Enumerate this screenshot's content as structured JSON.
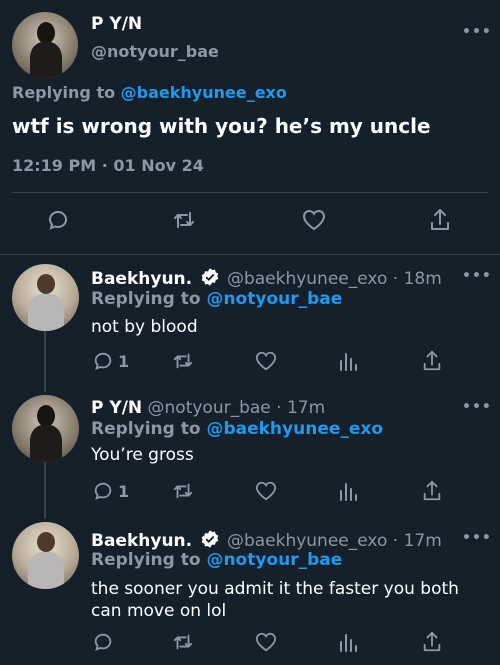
{
  "main_tweet": {
    "display_name": "P Y/N",
    "handle": "@notyour_bae",
    "replying_label": "Replying to",
    "replying_to": "@baekhyunee_exo",
    "text": "wtf is wrong with you? he’s my uncle",
    "timestamp": "12:19 PM · 01 Nov 24"
  },
  "replies": [
    {
      "display_name": "Baekhyun.",
      "handle": "@baekhyunee_exo",
      "time": "· 18m",
      "replying_label": "Replying to",
      "replying_to": "@notyour_bae",
      "text": "not by blood",
      "reply_count": "1",
      "verified": true
    },
    {
      "display_name": "P Y/N",
      "handle": "@notyour_bae",
      "time": "· 17m",
      "replying_label": "Replying to",
      "replying_to": "@baekhyunee_exo",
      "text": "You’re gross",
      "reply_count": "1",
      "verified": false
    },
    {
      "display_name": "Baekhyun.",
      "handle": "@baekhyunee_exo",
      "time": "· 17m",
      "replying_label": "Replying to",
      "replying_to": "@notyour_bae",
      "text": "the sooner you admit it the faster you both can move on lol",
      "reply_count": "",
      "verified": true
    }
  ],
  "colors": {
    "background": "#15202b",
    "accent": "#1d9bf0",
    "secondary_text": "#8b98a5",
    "divider": "#38444d"
  },
  "icons": [
    "more-icon",
    "reply-icon",
    "retweet-icon",
    "like-icon",
    "share-icon",
    "analytics-icon",
    "verified-icon"
  ]
}
